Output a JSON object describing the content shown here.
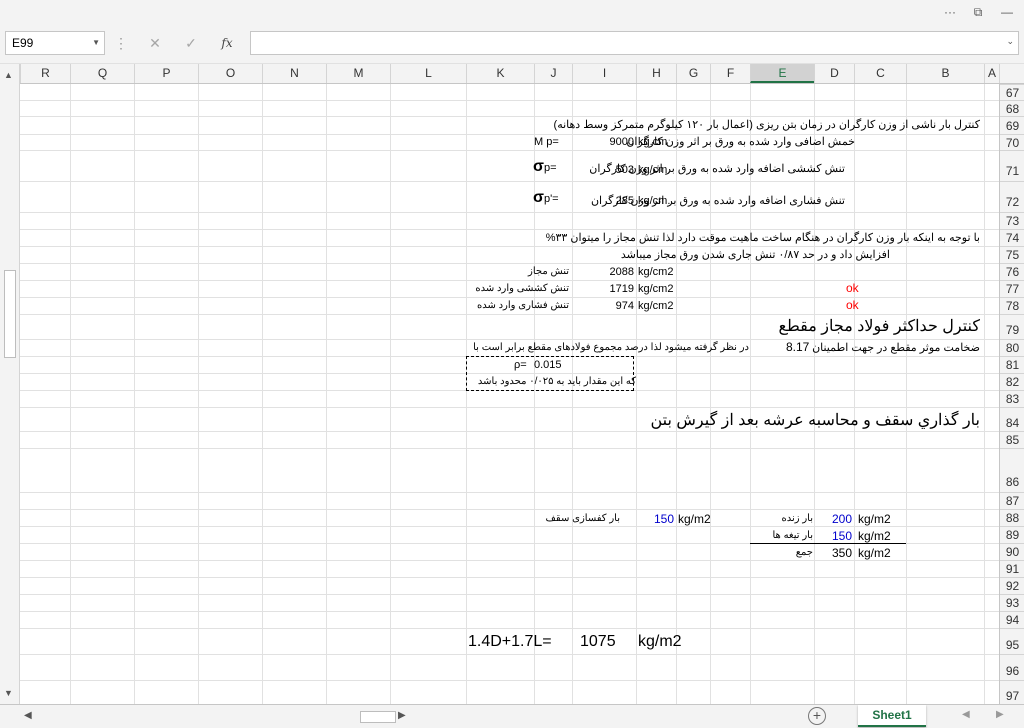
{
  "window": {
    "buttons": [
      "···",
      "⧉",
      "—"
    ]
  },
  "formula_bar": {
    "name_box": "E99",
    "cancel_icon": "✕",
    "enter_icon": "✓",
    "fx_label": "fx",
    "formula_value": ""
  },
  "columns": [
    "A",
    "B",
    "C",
    "D",
    "E",
    "F",
    "G",
    "H",
    "I",
    "J",
    "K",
    "L",
    "M",
    "N",
    "O",
    "P",
    "Q",
    "R"
  ],
  "selected_column": "E",
  "rows": [
    "67",
    "68",
    "69",
    "70",
    "71",
    "72",
    "73",
    "74",
    "75",
    "76",
    "77",
    "78",
    "79",
    "80",
    "81",
    "82",
    "83",
    "84",
    "85",
    "86",
    "87",
    "88",
    "89",
    "90",
    "91",
    "92",
    "93",
    "94",
    "95",
    "96",
    "97"
  ],
  "sheet": {
    "r69": "کنترل بار ناشی از وزن کارگران در زمان بتن ریزی (اعمال بار ۱۲۰ کیلوگرم متمرکز وسط دهانه)",
    "r70_desc": "خمش اضافی وارد شده به ورق بر اثر وزن کارگران",
    "r70_unit": "kg.cm",
    "r70_value": "9000",
    "r70_label": "M p=",
    "r71_desc": "تنش کششی اضافه وارد شده به ورق بر اثر وزن کارگران",
    "r71_unit": "kg/cm.",
    "r71_value": "503",
    "r71_sigma": "σ",
    "r71_label": "p=",
    "r72_desc": "تنش فشاری اضافه وارد شده به ورق بر اثر وزن کارگران",
    "r72_unit": "kg/cm.",
    "r72_value": "285",
    "r72_sigma": "σ",
    "r72_label": "p'=",
    "r74": "با توجه به اینکه بار وزن کارگران در هنگام ساخت ماهیت موقت دارد لذا تنش مجاز را میتوان ۳۳%",
    "r75": "افزایش داد و در حد ۰/۸۷ تنش جاری شدن ورق مجاز میباشد",
    "r76_value": "2088",
    "r76_unit": "kg/cm2",
    "r76_label": "تنش مجاز",
    "r77_ok": "ok",
    "r77_value": "1719",
    "r77_unit": "kg/cm2",
    "r77_label": "تنش کششی وارد شده",
    "r78_ok": "ok",
    "r78_value": "974",
    "r78_unit": "kg/cm2",
    "r78_label": "تنش فشاری وارد شده",
    "r79": "کنترل حداکثر فولاد مجاز مقطع",
    "r80_label": "ضخامت موثر مقطع در جهت اطمینان",
    "r80_value": "8.17",
    "r80_note": "در نظر گرفته میشود لذا درصد مجموع فولادهای مقطع برابر است با",
    "r81_label": "ρ=",
    "r81_value": "0.015",
    "r82": "که این مقدار باید به ۰/۰۲۵ محدود باشد",
    "r84": "بار گذاري سقف و محاسبه عرشه بعد از گيرش بتن",
    "r88_unit": "kg/m2",
    "r88_value": "200",
    "r88_label": "بار زنده",
    "r88_right_unit": "kg/m2",
    "r88_right_value": "150",
    "r88_right_label": "بار کفسازی سقف",
    "r89_unit": "kg/m2",
    "r89_value": "150",
    "r89_label": "بار تیغه ها",
    "r90_unit": "kg/m2",
    "r90_value": "350",
    "r90_label": "جمع",
    "r95_formula": "1.4D+1.7L=",
    "r95_value": "1075",
    "r95_unit": "kg/m2"
  },
  "tabs": {
    "sheet1": "Sheet1",
    "add": "+"
  },
  "colors": {
    "accent": "#217346",
    "ok": "#ff0000",
    "blue_values": "#0000cc"
  }
}
